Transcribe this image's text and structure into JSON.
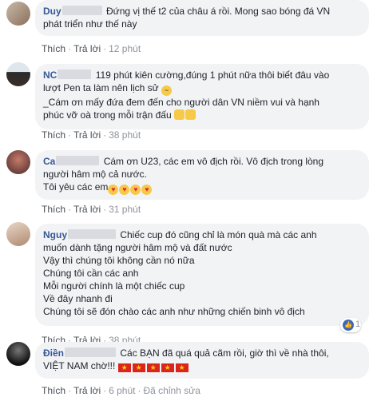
{
  "comments": [
    {
      "name": "Duy",
      "lines": [
        "Đứng vị thế t2 của châu á rồi. Mong sao bóng đá VN",
        "phát triển như thế này"
      ],
      "like": "Thích",
      "reply": "Trả lời",
      "time": "12 phút"
    },
    {
      "name": "NC",
      "lines": [
        "119 phút kiên cường,đúng 1 phút nữa thôi biết đâu vào",
        "lượt Pen ta làm nên lịch sử",
        "_Cám ơn mấy đứa đem đến cho người dân VN niềm vui và hạnh",
        "phúc vỡ oà trong mỗi trận đấu"
      ],
      "like": "Thích",
      "reply": "Trả lời",
      "time": "38 phút"
    },
    {
      "name": "Ca",
      "lines": [
        "Cám ơn U23, các em vô địch rồi. Vô địch trong lòng",
        "người hâm mộ cả nước.",
        "Tôi yêu các em"
      ],
      "like": "Thích",
      "reply": "Trả lời",
      "time": "31 phút"
    },
    {
      "name": "Nguy",
      "lines": [
        "Chiếc cup đó cũng chỉ là món quà mà các anh",
        "muốn dành tặng người hâm mộ và đất nước",
        "Vậy thì chúng tôi không cần nó nữa",
        "Chúng tôi cần các anh",
        "Mỗi người chính là một chiếc cup",
        "Về đây nhanh đi",
        "Chúng tôi sẽ đón chào các anh như những chiến binh vô địch"
      ],
      "like": "Thích",
      "reply": "Trả lời",
      "time": "38 phút",
      "reaction_count": "1"
    },
    {
      "name": "Điền",
      "lines": [
        "Các BẠN đã quá quả cãm rồi, giờ thì về nhà thôi,",
        "VIỆT NAM chờ!!!"
      ],
      "like": "Thích",
      "reply": "Trả lời",
      "time": "6 phút",
      "edited": "Đã chỉnh sửa"
    }
  ],
  "colors": {
    "name": "#365899",
    "bubble": "#f2f3f5",
    "meta": "#90949c"
  }
}
